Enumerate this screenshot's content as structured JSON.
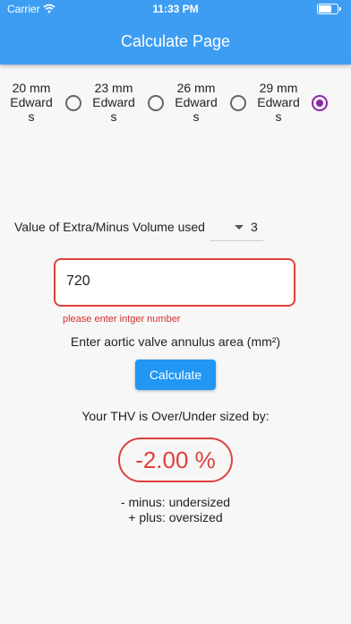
{
  "status": {
    "carrier": "Carrier",
    "time": "11:33 PM",
    "battery_level": 0.8
  },
  "header": {
    "title": "Calculate Page"
  },
  "valve_options": [
    {
      "line1": "20 mm",
      "line2": "Edward",
      "line3": "s",
      "selected": false
    },
    {
      "line1": "23 mm",
      "line2": "Edward",
      "line3": "s",
      "selected": false
    },
    {
      "line1": "26 mm",
      "line2": "Edward",
      "line3": "s",
      "selected": false
    },
    {
      "line1": "29 mm",
      "line2": "Edward",
      "line3": "s",
      "selected": true
    }
  ],
  "volume": {
    "label": "Value of Extra/Minus Volume used",
    "value": "3"
  },
  "annulus": {
    "value": "720",
    "error": "please enter intger number",
    "hint": "Enter aortic valve annulus area (mm²)"
  },
  "calculate_label": "Calculate",
  "result": {
    "label": "Your THV is Over/Under sized by:",
    "value": "-2.00 %",
    "minus_note": "- minus: undersized",
    "plus_note": "+ plus: oversized"
  },
  "colors": {
    "appbar": "#3d9df3",
    "accent": "#8e24aa",
    "error": "#e0413a",
    "button": "#2196f3"
  }
}
